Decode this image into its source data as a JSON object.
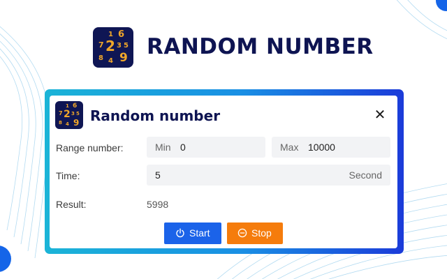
{
  "hero": {
    "title": "RANDOM NUMBER",
    "logo_digits": [
      "1",
      "6",
      "7",
      "2",
      "3",
      "5",
      "8",
      "4",
      "9"
    ]
  },
  "dialog": {
    "title": "Random number",
    "close_symbol": "✕",
    "range": {
      "label": "Range number:",
      "min_label": "Min",
      "min_value": "0",
      "max_label": "Max",
      "max_value": "10000"
    },
    "time": {
      "label": "Time:",
      "value": "5",
      "unit": "Second"
    },
    "result": {
      "label": "Result:",
      "value": "5998"
    },
    "buttons": {
      "start_label": "Start",
      "stop_label": "Stop"
    }
  },
  "colors": {
    "brand_navy": "#0e1452",
    "logo_bg": "#0f1654",
    "logo_digit": "#f0a72a",
    "start_blue": "#1b63e9",
    "stop_orange": "#f57c0c",
    "frame_gradient_start": "#1bb4d7",
    "frame_gradient_end": "#1b3bd9"
  }
}
